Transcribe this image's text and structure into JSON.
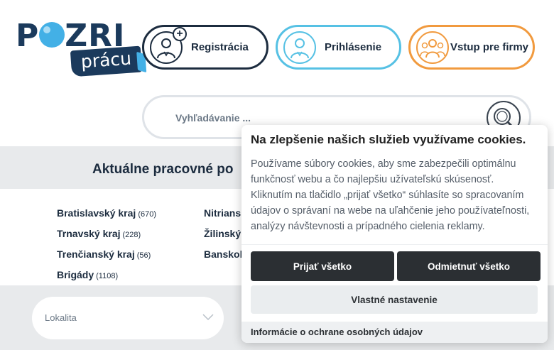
{
  "logo": {
    "main": "POZRI",
    "badge": "prácu"
  },
  "header": {
    "register_label": "Registrácia",
    "login_label": "Prihlásenie",
    "firms_label": "Vstup pre firmy"
  },
  "search": {
    "placeholder": "Vyhľadávanie ..."
  },
  "regions": {
    "title": "Aktuálne pracovné po",
    "items": [
      {
        "name": "Bratislavský kraj",
        "count": "(670)"
      },
      {
        "name": "Trnavský kraj",
        "count": "(228)"
      },
      {
        "name": "Trenčianský kraj",
        "count": "(56)"
      },
      {
        "name": "Brigády",
        "count": "(1108)"
      },
      {
        "name": "Nitrians",
        "count": ""
      },
      {
        "name": "Žilinský",
        "count": ""
      },
      {
        "name": "Banskob",
        "count": ""
      }
    ]
  },
  "filter": {
    "location_placeholder": "Lokalita"
  },
  "cookie": {
    "title": "Na zlepšenie našich služieb využívame cookies.",
    "text": "Používame súbory cookies, aby sme zabezpečili optimálnu funkčnosť webu a čo najlepšiu užívateľskú skúsenosť. Kliknutím na tlačidlo „prijať všetko“ súhlasíte so spracovaním údajov o správaní na webe na uľahčenie jeho používateľnosti, analýzy návštevnosti a prípadného cielenia reklamy.",
    "accept_label": "Prijať všetko",
    "reject_label": "Odmietnuť všetko",
    "custom_label": "Vlastné nastavenie",
    "privacy_label": "Informácie o ochrane osobných údajov"
  },
  "colors": {
    "navy": "#1b3a5c",
    "blue": "#43b0e6",
    "orange": "#f19a3e",
    "dark_button": "#2b2f33"
  }
}
